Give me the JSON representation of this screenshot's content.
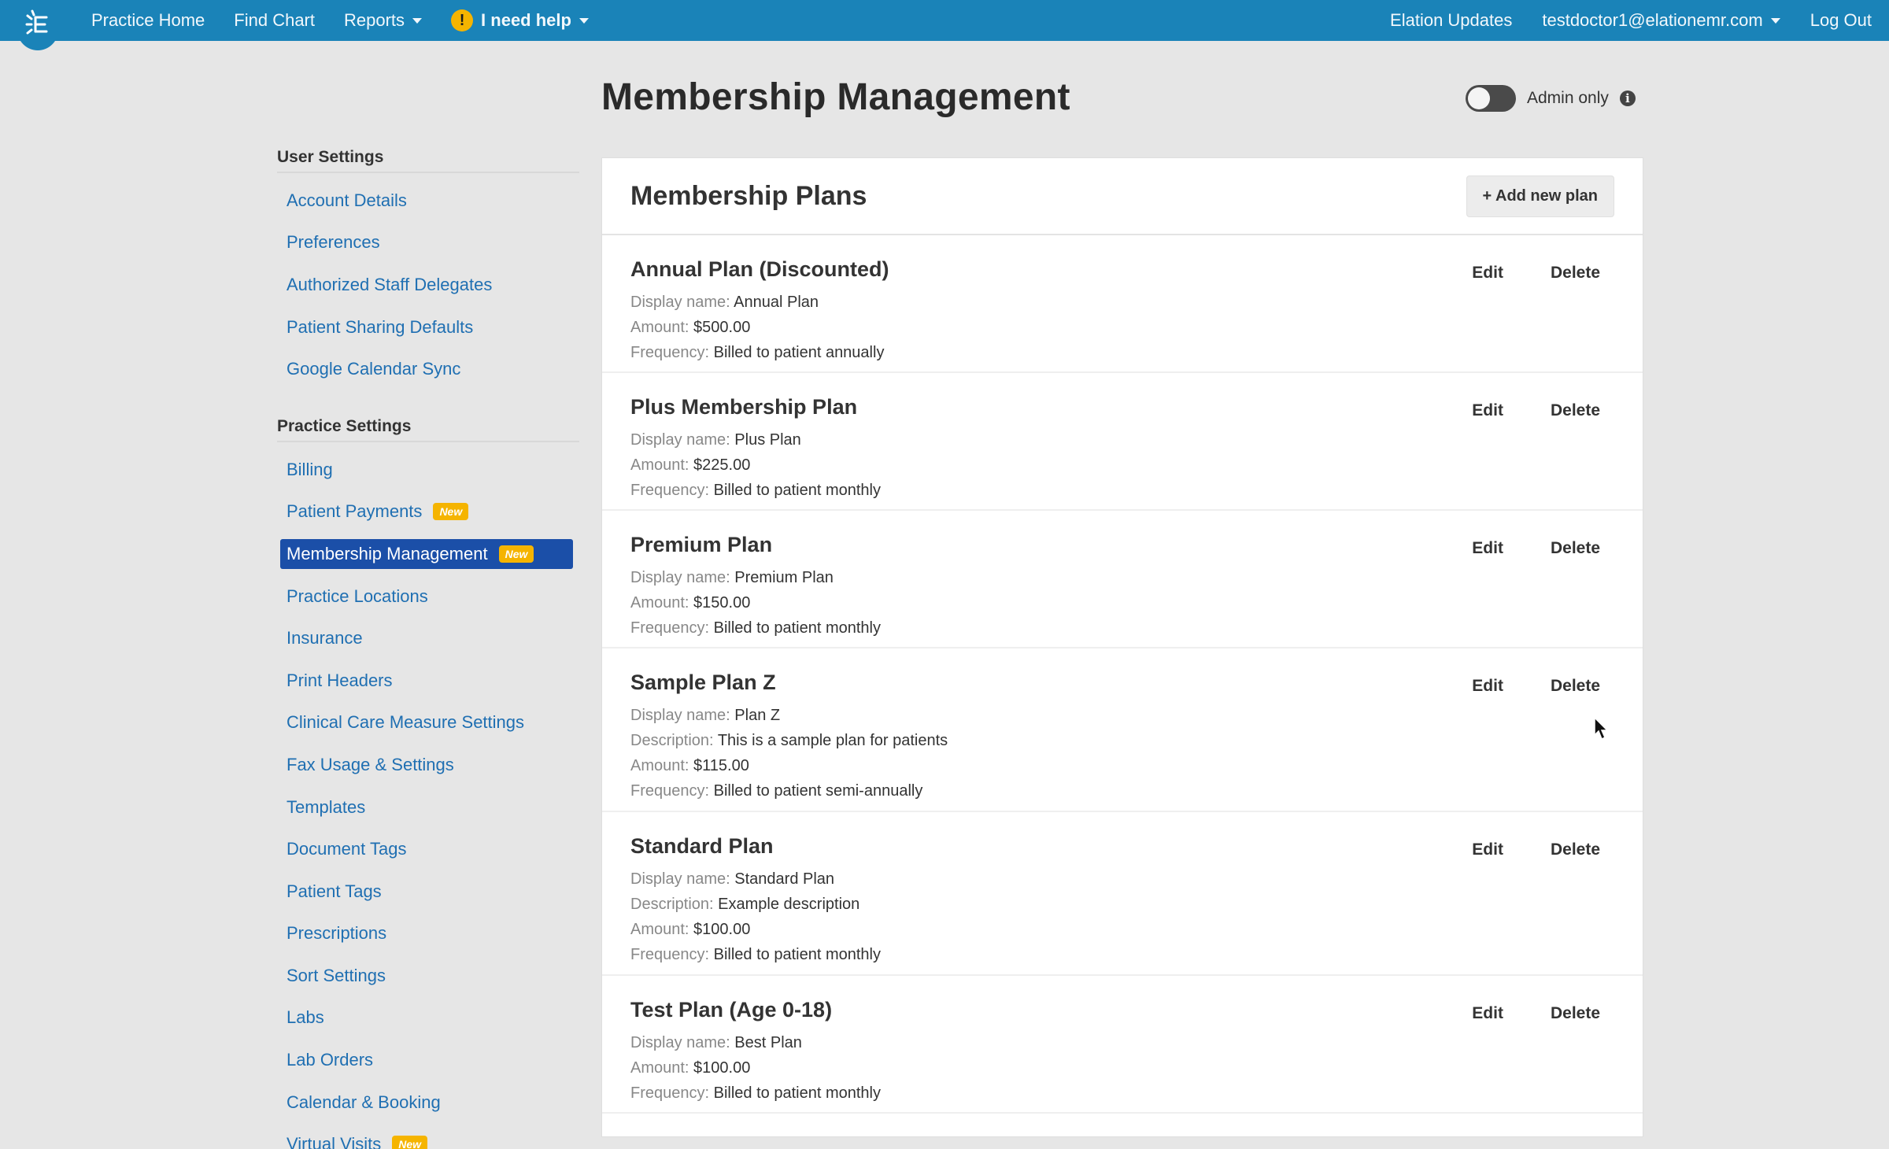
{
  "nav": {
    "left": [
      {
        "label": "Practice Home",
        "caret": false
      },
      {
        "label": "Find Chart",
        "caret": false
      },
      {
        "label": "Reports",
        "caret": true
      }
    ],
    "help": {
      "label": "I need help",
      "icon": "warning-icon"
    },
    "right": {
      "updates": "Elation Updates",
      "user": "testdoctor1@elationemr.com",
      "logout": "Log Out"
    }
  },
  "page": {
    "title": "Membership Management",
    "admin_toggle_label": "Admin only",
    "admin_toggle_on": false
  },
  "sidebar": {
    "user_title": "User Settings",
    "user_items": [
      "Account Details",
      "Preferences",
      "Authorized Staff Delegates",
      "Patient Sharing Defaults",
      "Google Calendar Sync"
    ],
    "practice_title": "Practice Settings",
    "new_badge": "New",
    "practice_items": [
      {
        "label": "Billing",
        "badge": false,
        "active": false
      },
      {
        "label": "Patient Payments",
        "badge": true,
        "active": false
      },
      {
        "label": "Membership Management",
        "badge": true,
        "active": true
      },
      {
        "label": "Practice Locations",
        "badge": false,
        "active": false
      },
      {
        "label": "Insurance",
        "badge": false,
        "active": false
      },
      {
        "label": "Print Headers",
        "badge": false,
        "active": false
      },
      {
        "label": "Clinical Care Measure Settings",
        "badge": false,
        "active": false
      },
      {
        "label": "Fax Usage & Settings",
        "badge": false,
        "active": false
      },
      {
        "label": "Templates",
        "badge": false,
        "active": false
      },
      {
        "label": "Document Tags",
        "badge": false,
        "active": false
      },
      {
        "label": "Patient Tags",
        "badge": false,
        "active": false
      },
      {
        "label": "Prescriptions",
        "badge": false,
        "active": false
      },
      {
        "label": "Sort Settings",
        "badge": false,
        "active": false
      },
      {
        "label": "Labs",
        "badge": false,
        "active": false
      },
      {
        "label": "Lab Orders",
        "badge": false,
        "active": false
      },
      {
        "label": "Calendar & Booking",
        "badge": false,
        "active": false
      },
      {
        "label": "Virtual Visits",
        "badge": true,
        "active": false
      }
    ]
  },
  "plans_card": {
    "title": "Membership Plans",
    "add_label": "+ Add new plan",
    "edit_label": "Edit",
    "delete_label": "Delete",
    "plans": [
      {
        "name": "Annual Plan (Discounted)",
        "fields": [
          {
            "key": "Display name:",
            "value": "Annual Plan"
          },
          {
            "key": "Amount:",
            "value": "$500.00"
          },
          {
            "key": "Frequency:",
            "value": "Billed to patient annually"
          }
        ]
      },
      {
        "name": "Plus Membership Plan",
        "fields": [
          {
            "key": "Display name:",
            "value": "Plus Plan"
          },
          {
            "key": "Amount:",
            "value": "$225.00"
          },
          {
            "key": "Frequency:",
            "value": "Billed to patient monthly"
          }
        ]
      },
      {
        "name": "Premium Plan",
        "fields": [
          {
            "key": "Display name:",
            "value": "Premium Plan"
          },
          {
            "key": "Amount:",
            "value": "$150.00"
          },
          {
            "key": "Frequency:",
            "value": "Billed to patient monthly"
          }
        ]
      },
      {
        "name": "Sample Plan Z",
        "fields": [
          {
            "key": "Display name:",
            "value": "Plan Z"
          },
          {
            "key": "Description:",
            "value": "This is a sample plan for patients"
          },
          {
            "key": "Amount:",
            "value": "$115.00"
          },
          {
            "key": "Frequency:",
            "value": "Billed to patient semi-annually"
          }
        ]
      },
      {
        "name": "Standard Plan",
        "fields": [
          {
            "key": "Display name:",
            "value": "Standard Plan"
          },
          {
            "key": "Description:",
            "value": "Example description"
          },
          {
            "key": "Amount:",
            "value": "$100.00"
          },
          {
            "key": "Frequency:",
            "value": "Billed to patient monthly"
          }
        ]
      },
      {
        "name": "Test Plan (Age 0-18)",
        "fields": [
          {
            "key": "Display name:",
            "value": "Best Plan"
          },
          {
            "key": "Amount:",
            "value": "$100.00"
          },
          {
            "key": "Frequency:",
            "value": "Billed to patient monthly"
          }
        ]
      }
    ]
  },
  "colors": {
    "topbar": "#1a83b8",
    "link": "#1f6fb2",
    "active_item": "#1b4fa8",
    "badge": "#f5b400",
    "background": "#e6e6e6"
  }
}
